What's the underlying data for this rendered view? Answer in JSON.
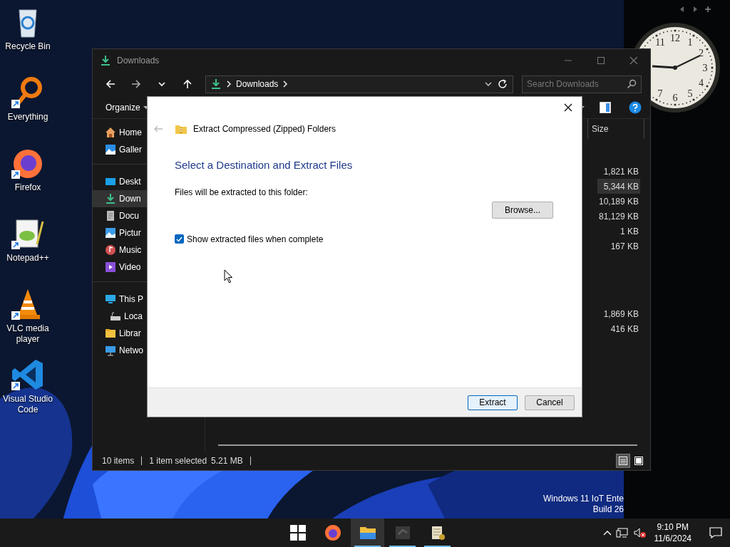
{
  "desktop_icons": [
    {
      "kind": "recycle",
      "label": "Recycle Bin",
      "shortcut": false
    },
    {
      "kind": "everything",
      "label": "Everything",
      "shortcut": true
    },
    {
      "kind": "firefox",
      "label": "Firefox",
      "shortcut": true
    },
    {
      "kind": "notepad",
      "label": "Notepad++",
      "shortcut": true
    },
    {
      "kind": "vlc",
      "label": "VLC media player",
      "shortcut": true
    },
    {
      "kind": "vscode",
      "label": "Visual Studio Code",
      "shortcut": true
    }
  ],
  "clock_widget": {
    "numerals": [
      "11",
      "12",
      "1",
      "2",
      "3",
      "4",
      "5",
      "6",
      "7"
    ]
  },
  "explorer": {
    "title": "Downloads",
    "address": {
      "segment": "Downloads"
    },
    "search": {
      "placeholder": "Search Downloads"
    },
    "organize": "Organize",
    "sidebar_sections": [
      {
        "items": [
          {
            "kind": "home",
            "label": "Home",
            "selected": false
          },
          {
            "kind": "gallery",
            "label": "Galler",
            "selected": false
          }
        ]
      },
      {
        "items": [
          {
            "kind": "desktop",
            "label": "Deskt",
            "selected": false
          },
          {
            "kind": "downloads",
            "label": "Down",
            "selected": true
          },
          {
            "kind": "documents",
            "label": "Docu",
            "selected": false
          },
          {
            "kind": "pictures",
            "label": "Pictur",
            "selected": false
          },
          {
            "kind": "music",
            "label": "Music",
            "selected": false
          },
          {
            "kind": "videos",
            "label": "Video",
            "selected": false
          }
        ]
      },
      {
        "items": [
          {
            "kind": "pc",
            "label": "This P",
            "selected": false,
            "children": [
              {
                "kind": "drive",
                "label": "Loca",
                "selected": false
              }
            ]
          },
          {
            "kind": "libraries",
            "label": "Librar",
            "selected": false
          },
          {
            "kind": "network",
            "label": "Netwo",
            "selected": false
          }
        ]
      }
    ],
    "size_column": "Size",
    "file_groups": [
      {
        "rows": [
          {
            "size": "1,821 KB",
            "selected": false
          },
          {
            "size": "5,344 KB",
            "selected": true
          },
          {
            "size": "10,189 KB",
            "selected": false
          },
          {
            "size": "81,129 KB",
            "selected": false
          },
          {
            "size": "1 KB",
            "selected": false
          },
          {
            "size": "167 KB",
            "selected": false
          }
        ]
      },
      {
        "rows": [
          {
            "size": "1,869 KB",
            "selected": false
          },
          {
            "size": "416 KB",
            "selected": false
          }
        ]
      }
    ],
    "status": {
      "count": "10 items",
      "selection": "1 item selected",
      "selection_size": "5.21 MB"
    },
    "view_buttons": [
      {
        "kind": "details",
        "selected": true
      },
      {
        "kind": "tiles",
        "selected": false
      }
    ]
  },
  "dialog": {
    "title": "Extract Compressed (Zipped) Folders",
    "back_disabled": true,
    "heading": "Select a Destination and Extract Files",
    "folder_label": "Files will be extracted to this folder:",
    "browse": "Browse...",
    "show_files": {
      "label": "Show extracted files when complete",
      "checked": true
    },
    "buttons": [
      {
        "label": "Extract",
        "default": true
      },
      {
        "label": "Cancel",
        "default": false
      }
    ]
  },
  "desktop_version": [
    "Windows 11 IoT Ente",
    "Build 26"
  ],
  "taskbar": {
    "apps": [
      {
        "kind": "start",
        "running": false,
        "active": false
      },
      {
        "kind": "firefox",
        "running": false,
        "active": false
      },
      {
        "kind": "explorer",
        "running": true,
        "active": true
      },
      {
        "kind": "dark-app",
        "running": true,
        "active": false
      },
      {
        "kind": "archive",
        "running": true,
        "active": false
      }
    ],
    "time": "9:10 PM",
    "date": "11/6/2024",
    "volume_muted": true
  }
}
